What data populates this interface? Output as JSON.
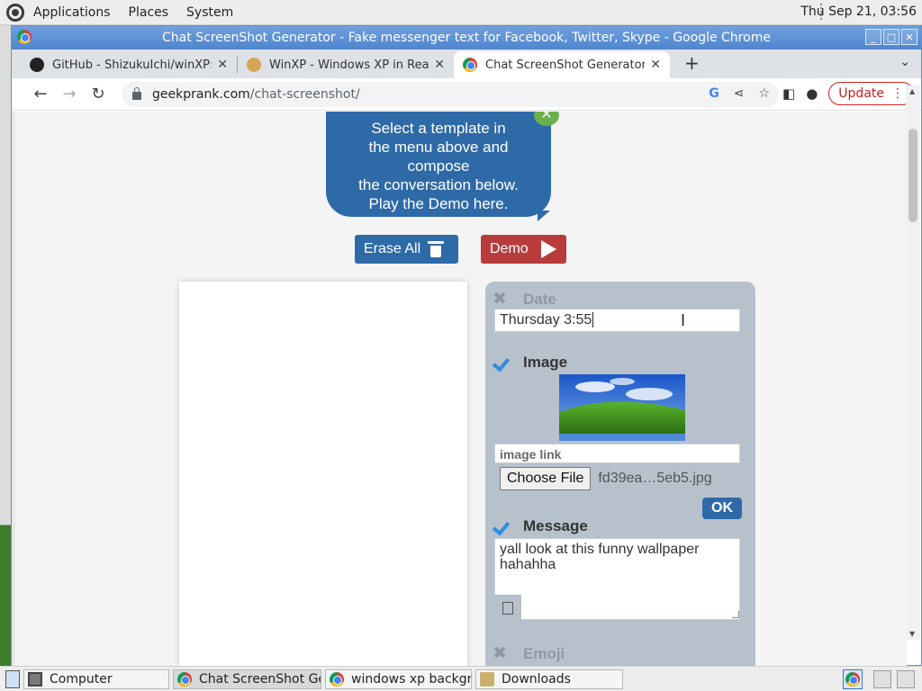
{
  "top_panel": {
    "menus": [
      "Applications",
      "Places",
      "System"
    ],
    "clock": "Thu Sep 21, 03:56"
  },
  "window": {
    "title": "Chat ScreenShot Generator - Fake messenger text for Facebook, Twitter, Skype - Google Chrome",
    "buttons": [
      "minimize",
      "maximize",
      "close"
    ]
  },
  "tabs": [
    {
      "title": "GitHub - ShizukuIchi/winXP: \\",
      "icon": "github-icon",
      "active": false
    },
    {
      "title": "WinXP - Windows XP in React",
      "icon": "doge-icon",
      "active": false
    },
    {
      "title": "Chat ScreenShot Generator - F",
      "icon": "chrome-icon",
      "active": true
    }
  ],
  "toolbar": {
    "url_host": "geekprank.com",
    "url_path": "/chat-screenshot/",
    "update_label": "Update"
  },
  "page": {
    "bubble_text": "Select a template in\nthe menu above and\ncompose\nthe conversation below.\nPlay the Demo here.",
    "erase_label": "Erase All",
    "demo_label": "Demo",
    "editor": {
      "date_label": "Date",
      "date_value": "Thursday 3:55",
      "date_enabled": false,
      "image_label": "Image",
      "image_enabled": true,
      "image_link_placeholder": "image link",
      "choose_file_label": "Choose File",
      "file_name": "fd39ea…5eb5.jpg",
      "ok_label": "OK",
      "message_label": "Message",
      "message_enabled": true,
      "message_value": "yall look at this funny wallpaper\nhahahha",
      "emoji_label": "Emoji",
      "emoji_enabled": false
    }
  },
  "taskbar": {
    "items": [
      {
        "label": "Computer",
        "icon": "computer-icon"
      },
      {
        "label": "Chat ScreenShot Ge…",
        "icon": "chrome-icon",
        "active": true
      },
      {
        "label": "windows xp backgr…",
        "icon": "chrome-icon"
      },
      {
        "label": "Downloads",
        "icon": "folder-icon"
      }
    ]
  },
  "colors": {
    "bubble": "#2f6aa8",
    "demo": "#b83c3c",
    "panel": "#b7c1cc",
    "check": "#2d8de0"
  }
}
